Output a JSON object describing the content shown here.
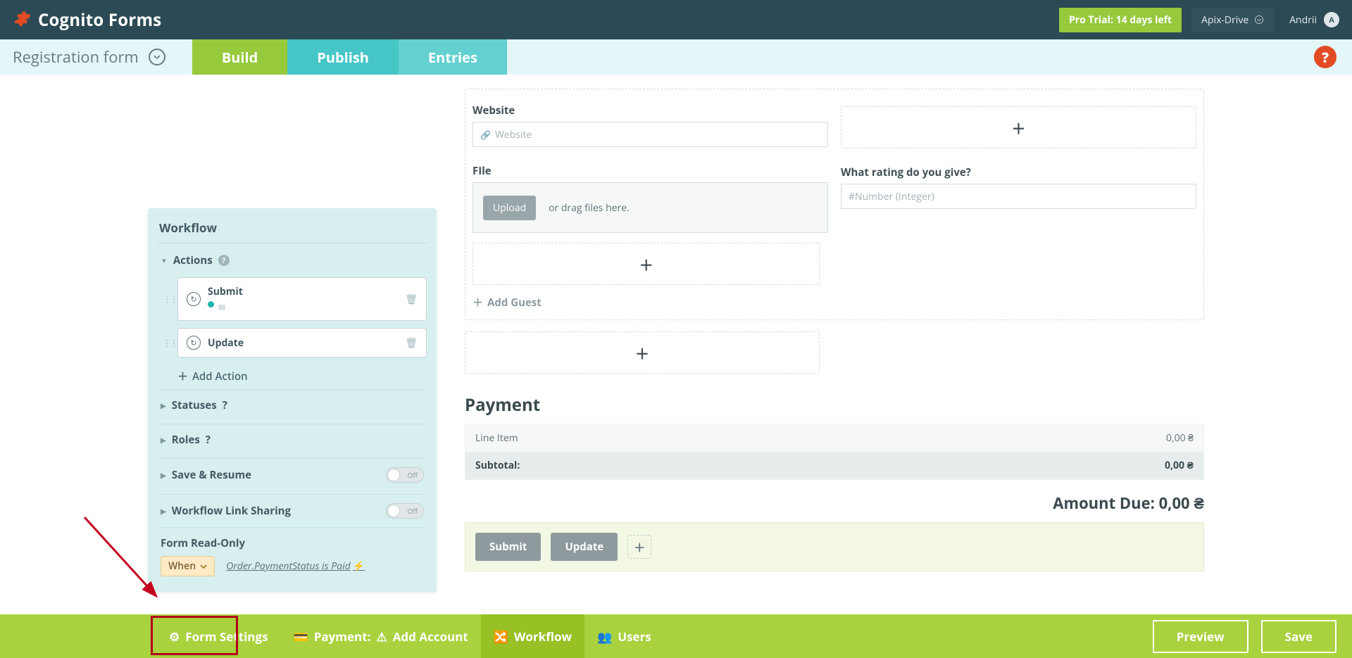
{
  "topbar": {
    "logo_text": "Cognito Forms",
    "pro_trial": "Pro Trial: 14 days left",
    "org_name": "Apix-Drive",
    "user_name": "Andrii",
    "user_initial": "A"
  },
  "subbar": {
    "form_title": "Registration form",
    "tabs": {
      "build": "Build",
      "publish": "Publish",
      "entries": "Entries"
    },
    "help": "?"
  },
  "workflow": {
    "title": "Workflow",
    "actions_label": "Actions",
    "action_submit": "Submit",
    "action_update": "Update",
    "add_action": "Add Action",
    "statuses": "Statuses",
    "roles": "Roles",
    "save_resume": "Save & Resume",
    "link_sharing": "Workflow Link Sharing",
    "off_label": "Off",
    "readonly_label": "Form Read-Only",
    "when_label": "When",
    "readonly_expr": "Order.PaymentStatus is Paid"
  },
  "builder": {
    "website_label": "Website",
    "website_placeholder": "Website",
    "file_label": "FIle",
    "upload_btn": "Upload",
    "upload_hint": "or drag files here.",
    "rating_label": "What rating do you give?",
    "rating_placeholder": "#Number (Integer)",
    "add_guest": "Add Guest",
    "payment_title": "Payment",
    "line_item_label": "Line Item",
    "line_item_value": "0,00 ₴",
    "subtotal_label": "Subtotal:",
    "subtotal_value": "0,00 ₴",
    "amount_due_label": "Amount Due: 0,00 ₴",
    "submit_btn": "Submit",
    "update_btn": "Update"
  },
  "bottombar": {
    "form_settings": "Form Settings",
    "payment_prefix": "Payment: ",
    "payment_add_account": "Add Account",
    "workflow": "Workflow",
    "users": "Users",
    "preview": "Preview",
    "save": "Save"
  },
  "chart_data": null
}
